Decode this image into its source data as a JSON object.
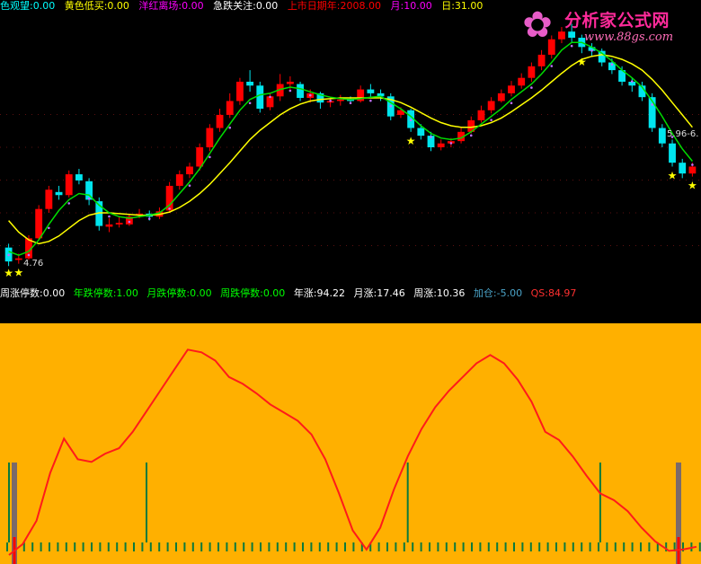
{
  "top_legend": [
    {
      "text": "色观望:0.00",
      "color": "#00ffff"
    },
    {
      "text": "黄色低买:0.00",
      "color": "#ffff00"
    },
    {
      "text": "洋红离场:0.00",
      "color": "#ff00ff"
    },
    {
      "text": "急跌关注:0.00",
      "color": "#ffffff"
    },
    {
      "text": "上市日期年:2008.00",
      "color": "#ff0000"
    },
    {
      "text": "月:10.00",
      "color": "#ff00ff"
    },
    {
      "text": "日:31.00",
      "color": "#ffff00"
    }
  ],
  "mid_legend": [
    {
      "text": "周涨停数:0.00",
      "color": "#ffffff"
    },
    {
      "text": "年跌停数:1.00",
      "color": "#00ff00"
    },
    {
      "text": "月跌停数:0.00",
      "color": "#00ff00"
    },
    {
      "text": "周跌停数:0.00",
      "color": "#00ff00"
    },
    {
      "text": "年涨:94.22",
      "color": "#ffffff"
    },
    {
      "text": "月涨:17.46",
      "color": "#ffffff"
    },
    {
      "text": "周涨:10.36",
      "color": "#ffffff"
    },
    {
      "text": "加仓:-5.00",
      "color": "#4aa3c8"
    },
    {
      "text": "QS:84.97",
      "color": "#ff3030"
    }
  ],
  "watermark": {
    "title": "分析家公式网",
    "url": "www.88gs.com"
  },
  "price_labels": {
    "low": "4.76",
    "right": "5.96-6."
  },
  "colors": {
    "top_bg": "#000000",
    "bottom_bg": "#ffb000",
    "up": "#ff0000",
    "down": "#00e5ee",
    "fast_ma": "#00dd00",
    "slow_ma": "#ffff00",
    "qs_line": "#ff1a1a",
    "signal": "#0a7a3c",
    "star": "#ffff00"
  },
  "chart_data": [
    {
      "type": "candlestick",
      "note_series": "price panel",
      "candles": [
        [
          5.0,
          4.82,
          5.05,
          4.76
        ],
        [
          4.84,
          4.86,
          4.92,
          4.79
        ],
        [
          4.86,
          5.12,
          5.16,
          4.84
        ],
        [
          5.12,
          5.5,
          5.55,
          5.1
        ],
        [
          5.5,
          5.75,
          5.8,
          5.45
        ],
        [
          5.72,
          5.68,
          5.8,
          5.62
        ],
        [
          5.68,
          5.95,
          6.0,
          5.65
        ],
        [
          5.95,
          5.87,
          6.02,
          5.82
        ],
        [
          5.86,
          5.62,
          5.9,
          5.55
        ],
        [
          5.6,
          5.28,
          5.65,
          5.22
        ],
        [
          5.27,
          5.3,
          5.38,
          5.2
        ],
        [
          5.3,
          5.32,
          5.4,
          5.26
        ],
        [
          5.3,
          5.4,
          5.44,
          5.28
        ],
        [
          5.42,
          5.44,
          5.5,
          5.38
        ],
        [
          5.44,
          5.4,
          5.48,
          5.35
        ],
        [
          5.4,
          5.47,
          5.52,
          5.37
        ],
        [
          5.48,
          5.8,
          5.85,
          5.45
        ],
        [
          5.8,
          5.95,
          6.0,
          5.75
        ],
        [
          5.95,
          6.05,
          6.1,
          5.9
        ],
        [
          6.05,
          6.3,
          6.35,
          6.0
        ],
        [
          6.3,
          6.55,
          6.6,
          6.25
        ],
        [
          6.55,
          6.72,
          6.8,
          6.5
        ],
        [
          6.72,
          6.9,
          7.0,
          6.68
        ],
        [
          6.9,
          7.15,
          7.2,
          6.85
        ],
        [
          7.15,
          7.1,
          7.3,
          7.02
        ],
        [
          7.1,
          6.8,
          7.15,
          6.75
        ],
        [
          6.82,
          6.96,
          7.0,
          6.78
        ],
        [
          6.96,
          7.12,
          7.25,
          6.9
        ],
        [
          7.12,
          7.15,
          7.22,
          7.05
        ],
        [
          7.12,
          6.94,
          7.15,
          6.9
        ],
        [
          6.94,
          7.0,
          7.05,
          6.88
        ],
        [
          7.0,
          6.88,
          7.02,
          6.8
        ],
        [
          6.88,
          6.9,
          6.95,
          6.82
        ],
        [
          6.9,
          6.92,
          6.98,
          6.84
        ],
        [
          6.92,
          6.9,
          6.96,
          6.86
        ],
        [
          6.9,
          7.05,
          7.1,
          6.88
        ],
        [
          7.05,
          7.0,
          7.12,
          6.95
        ],
        [
          7.0,
          6.96,
          7.05,
          6.9
        ],
        [
          6.96,
          6.7,
          7.0,
          6.65
        ],
        [
          6.72,
          6.78,
          6.82,
          6.68
        ],
        [
          6.78,
          6.55,
          6.8,
          6.5
        ],
        [
          6.55,
          6.45,
          6.6,
          6.4
        ],
        [
          6.45,
          6.3,
          6.5,
          6.25
        ],
        [
          6.3,
          6.35,
          6.4,
          6.26
        ],
        [
          6.35,
          6.38,
          6.42,
          6.3
        ],
        [
          6.38,
          6.5,
          6.55,
          6.35
        ],
        [
          6.5,
          6.65,
          6.7,
          6.48
        ],
        [
          6.65,
          6.78,
          6.84,
          6.62
        ],
        [
          6.78,
          6.9,
          6.95,
          6.74
        ],
        [
          6.9,
          7.0,
          7.05,
          6.88
        ],
        [
          7.0,
          7.1,
          7.16,
          6.96
        ],
        [
          7.1,
          7.2,
          7.26,
          7.06
        ],
        [
          7.2,
          7.35,
          7.4,
          7.15
        ],
        [
          7.35,
          7.5,
          7.56,
          7.3
        ],
        [
          7.5,
          7.7,
          7.75,
          7.45
        ],
        [
          7.7,
          7.8,
          7.86,
          7.65
        ],
        [
          7.8,
          7.72,
          7.9,
          7.65
        ],
        [
          7.72,
          7.6,
          7.76,
          7.52
        ],
        [
          7.6,
          7.55,
          7.65,
          7.48
        ],
        [
          7.55,
          7.4,
          7.58,
          7.35
        ],
        [
          7.4,
          7.3,
          7.45,
          7.25
        ],
        [
          7.3,
          7.15,
          7.35,
          7.1
        ],
        [
          7.15,
          7.1,
          7.2,
          7.02
        ],
        [
          7.1,
          6.95,
          7.15,
          6.9
        ],
        [
          6.95,
          6.55,
          7.0,
          6.5
        ],
        [
          6.55,
          6.35,
          6.6,
          6.3
        ],
        [
          6.35,
          6.1,
          6.4,
          6.05
        ],
        [
          6.1,
          5.96,
          6.15,
          5.9
        ],
        [
          5.96,
          6.05,
          6.1,
          5.92
        ]
      ],
      "fast_ma": [
        4.95,
        4.9,
        4.95,
        5.1,
        5.3,
        5.48,
        5.62,
        5.7,
        5.68,
        5.55,
        5.45,
        5.4,
        5.38,
        5.4,
        5.42,
        5.45,
        5.55,
        5.7,
        5.85,
        6.02,
        6.22,
        6.42,
        6.6,
        6.78,
        6.92,
        6.98,
        7.0,
        7.05,
        7.08,
        7.06,
        7.02,
        6.98,
        6.95,
        6.93,
        6.92,
        6.93,
        6.95,
        6.96,
        6.88,
        6.8,
        6.7,
        6.58,
        6.48,
        6.42,
        6.4,
        6.42,
        6.5,
        6.6,
        6.7,
        6.8,
        6.92,
        7.02,
        7.12,
        7.25,
        7.4,
        7.56,
        7.66,
        7.66,
        7.6,
        7.52,
        7.42,
        7.3,
        7.2,
        7.08,
        6.9,
        6.7,
        6.48,
        6.28,
        6.12
      ],
      "slow_ma": [
        5.35,
        5.2,
        5.1,
        5.05,
        5.08,
        5.15,
        5.25,
        5.35,
        5.42,
        5.45,
        5.45,
        5.44,
        5.43,
        5.42,
        5.42,
        5.43,
        5.46,
        5.52,
        5.6,
        5.7,
        5.82,
        5.96,
        6.1,
        6.25,
        6.4,
        6.52,
        6.62,
        6.72,
        6.8,
        6.86,
        6.9,
        6.92,
        6.93,
        6.94,
        6.94,
        6.94,
        6.94,
        6.94,
        6.92,
        6.88,
        6.82,
        6.75,
        6.68,
        6.62,
        6.58,
        6.56,
        6.56,
        6.58,
        6.62,
        6.68,
        6.76,
        6.85,
        6.94,
        7.04,
        7.15,
        7.26,
        7.36,
        7.44,
        7.48,
        7.5,
        7.48,
        7.44,
        7.38,
        7.3,
        7.18,
        7.04,
        6.88,
        6.72,
        6.56
      ],
      "ylim": [
        4.6,
        8.0
      ]
    },
    {
      "type": "line",
      "note_series": "QS oscillator panel",
      "series": [
        {
          "name": "QS",
          "values": [
            0,
            8,
            25,
            60,
            85,
            70,
            68,
            74,
            78,
            90,
            105,
            120,
            135,
            150,
            148,
            142,
            130,
            125,
            118,
            110,
            104,
            98,
            88,
            70,
            45,
            18,
            4,
            20,
            48,
            72,
            92,
            108,
            120,
            130,
            140,
            146,
            140,
            128,
            112,
            90,
            84,
            72,
            58,
            45,
            40,
            32,
            20,
            10,
            3,
            4,
            6
          ]
        }
      ],
      "ylim": [
        0,
        160
      ],
      "signals": [
        0,
        10,
        29,
        43,
        67,
        81
      ]
    }
  ]
}
